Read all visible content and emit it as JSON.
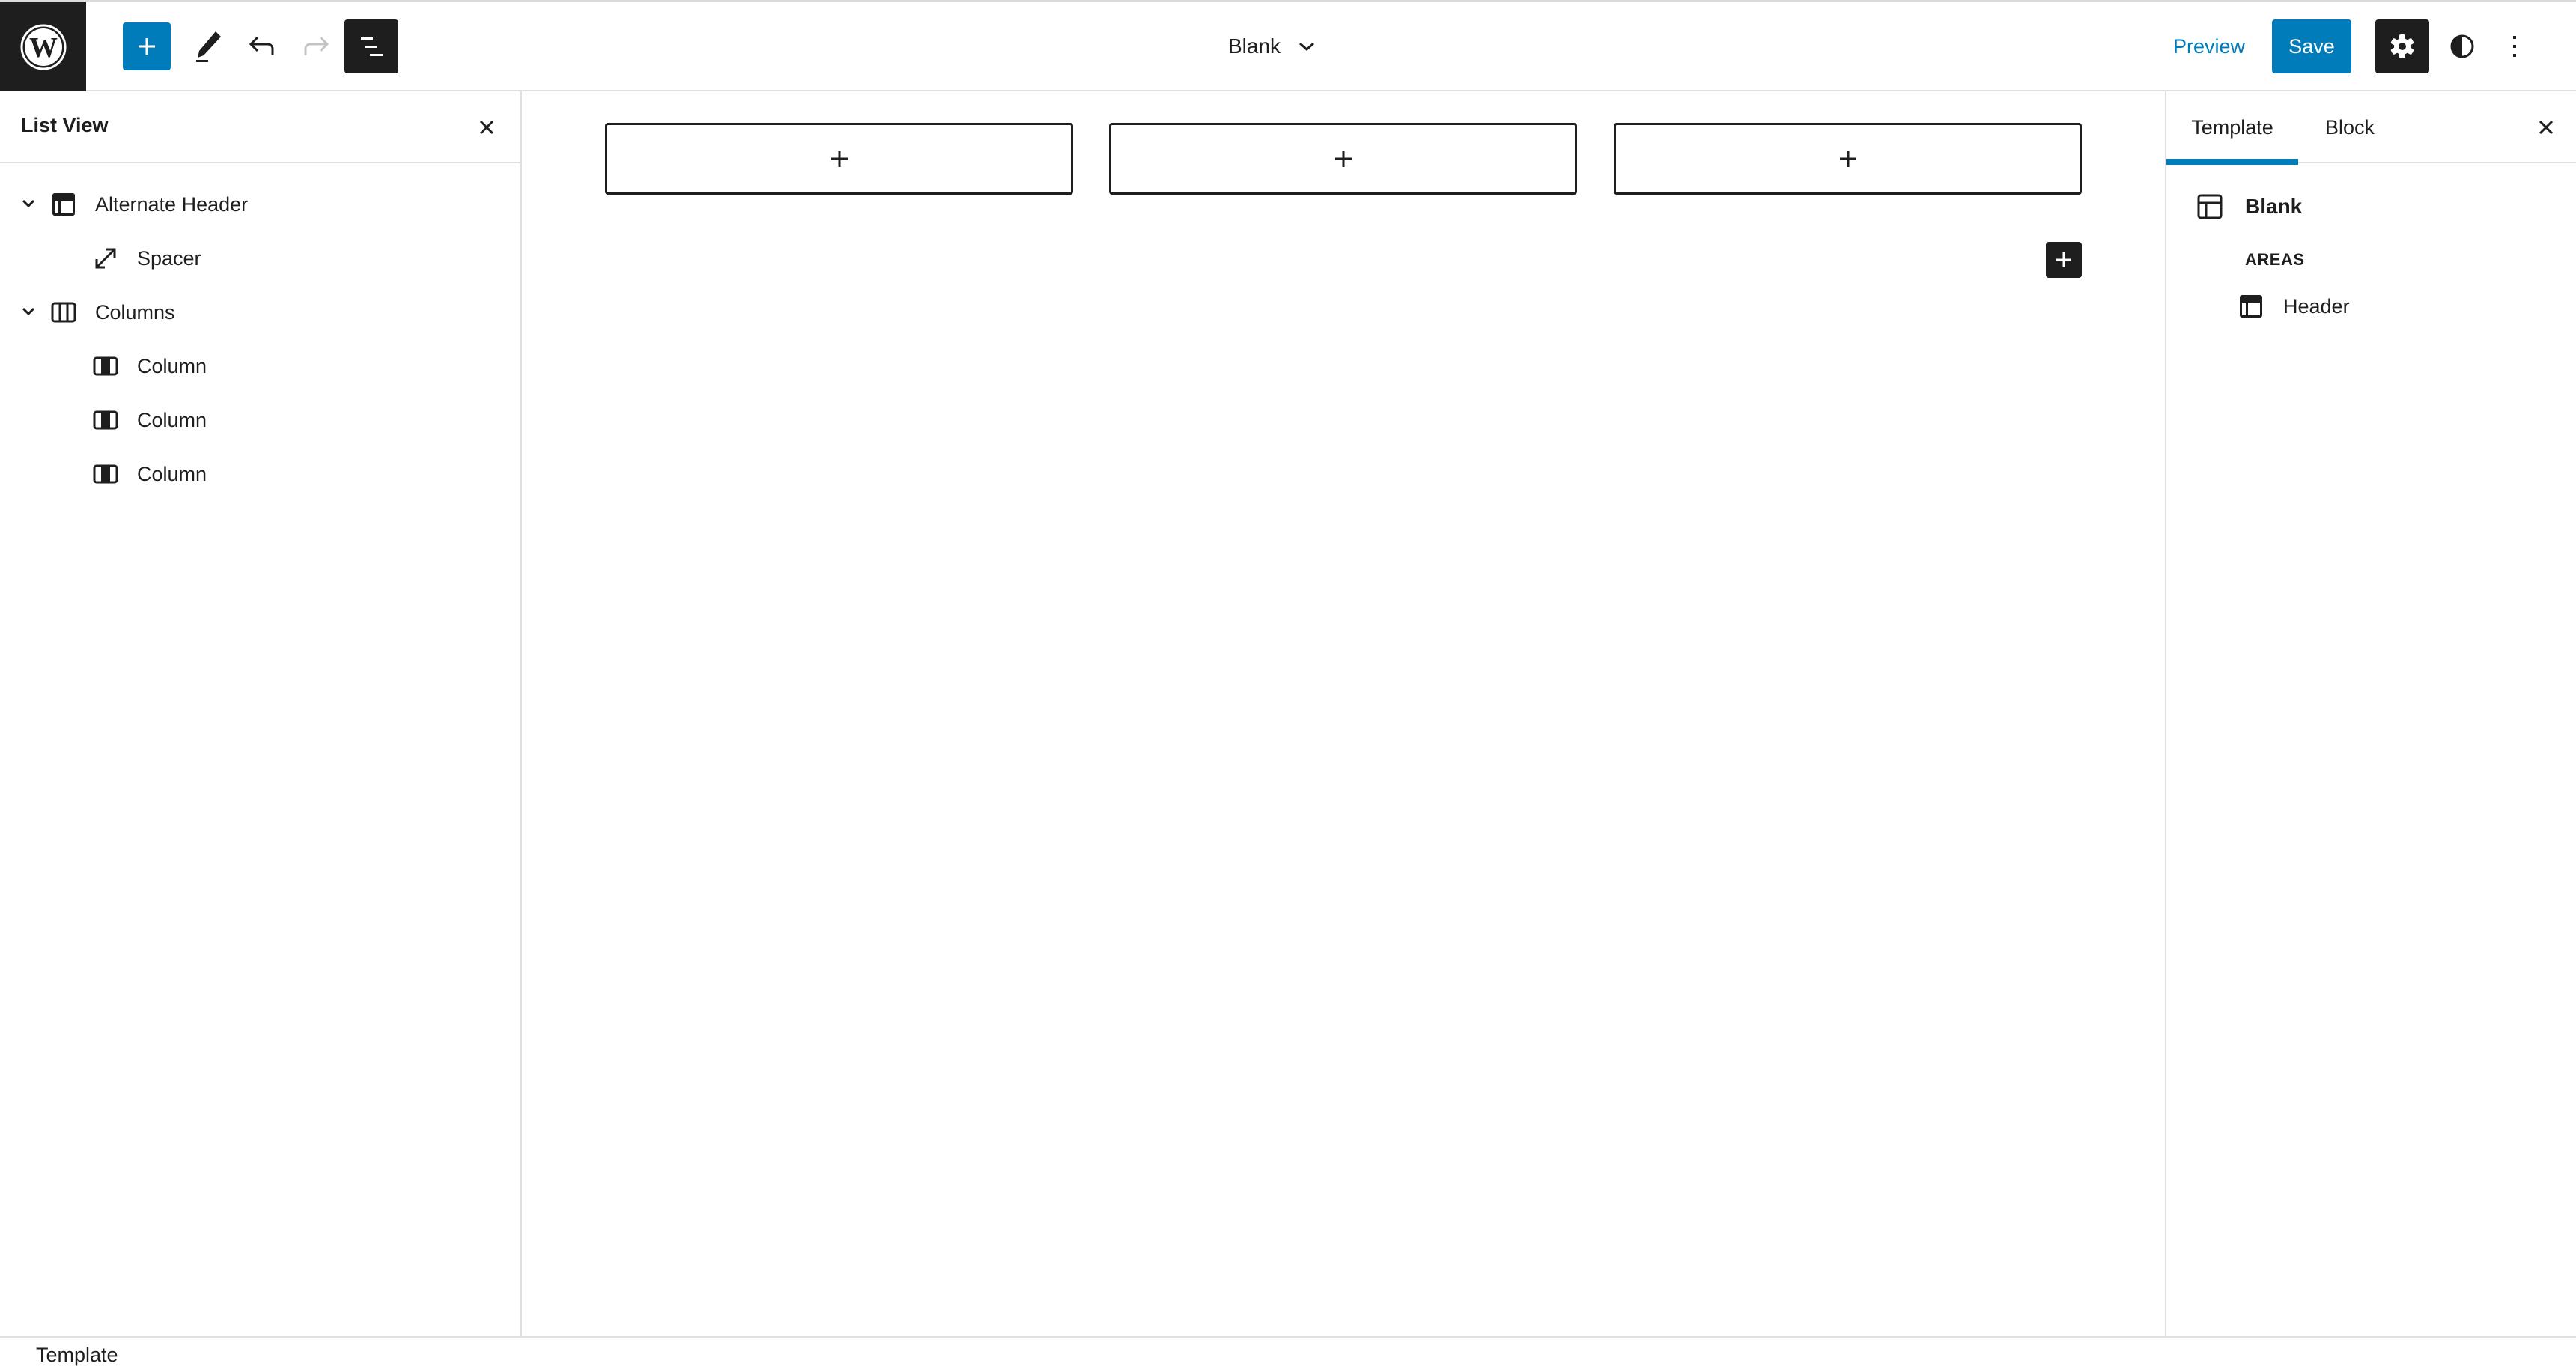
{
  "header": {
    "logo_icon": "wordpress-logo-icon",
    "add_block_icon": "plus-icon",
    "tools_icon": "pencil-icon",
    "undo_icon": "undo-icon",
    "redo_icon": "redo-icon",
    "list_view_icon": "list-view-icon",
    "document_title": "Blank",
    "document_title_icon": "chevron-down-icon",
    "preview_label": "Preview",
    "save_label": "Save",
    "settings_icon": "gear-icon",
    "styles_icon": "contrast-icon",
    "more_icon": "kebab-vertical-icon",
    "colors": {
      "accent": "#007cba",
      "dark": "#1e1e1e",
      "disabled": "#c4c4c4"
    }
  },
  "list_view": {
    "title": "List View",
    "close_icon": "close-icon",
    "items": [
      {
        "label": "Alternate Header",
        "icon": "template-part-header-icon",
        "level": 1,
        "expanded": true
      },
      {
        "label": "Spacer",
        "icon": "resize-arrows-icon",
        "level": 2
      },
      {
        "label": "Columns",
        "icon": "columns-icon",
        "level": 1,
        "expanded": true
      },
      {
        "label": "Column",
        "icon": "column-icon",
        "level": 2
      },
      {
        "label": "Column",
        "icon": "column-icon",
        "level": 2
      },
      {
        "label": "Column",
        "icon": "column-icon",
        "level": 2
      }
    ]
  },
  "canvas": {
    "columns": [
      {
        "appender_icon": "plus-icon"
      },
      {
        "appender_icon": "plus-icon"
      },
      {
        "appender_icon": "plus-icon"
      }
    ],
    "block_appender_icon": "plus-icon"
  },
  "settings_sidebar": {
    "tabs": [
      {
        "label": "Template",
        "active": true
      },
      {
        "label": "Block",
        "active": false
      }
    ],
    "close_icon": "close-icon",
    "template_name": "Blank",
    "template_icon": "layout-icon",
    "areas_label": "AREAS",
    "areas": [
      {
        "label": "Header",
        "icon": "template-part-header-icon"
      }
    ]
  },
  "footer": {
    "breadcrumb": "Template"
  }
}
